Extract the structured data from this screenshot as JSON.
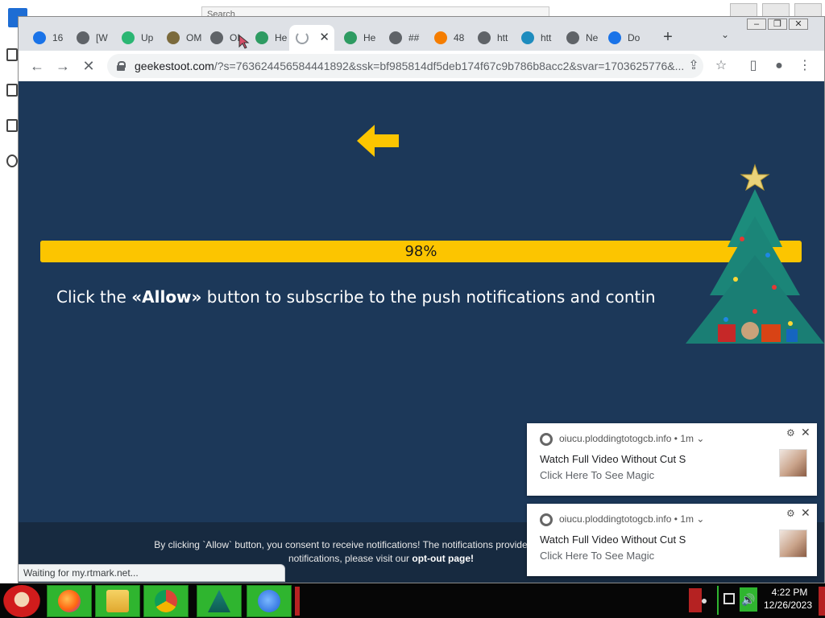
{
  "desktop": {
    "bg_window_search": "Search"
  },
  "browser": {
    "tabs": [
      {
        "label": "16",
        "favicon": "edge-icon",
        "color": "#1a73e8"
      },
      {
        "label": "[W",
        "favicon": "globe-icon",
        "color": "#5f6368"
      },
      {
        "label": "Up",
        "favicon": "upload-icon",
        "color": "#2bb673"
      },
      {
        "label": "OM",
        "favicon": "image-icon",
        "color": "#7b6a3c"
      },
      {
        "label": "OI",
        "favicon": "globe-icon",
        "color": "#5f6368"
      },
      {
        "label": "He",
        "favicon": "palm-icon",
        "color": "#2e9b62"
      },
      {
        "label": "",
        "favicon": "loading-spinner-icon",
        "color": "#9aa0a6",
        "active": true
      },
      {
        "label": "He",
        "favicon": "palm-icon",
        "color": "#2e9b62"
      },
      {
        "label": "##",
        "favicon": "globe-icon",
        "color": "#5f6368"
      },
      {
        "label": "48",
        "favicon": "blogger-icon",
        "color": "#f57d00"
      },
      {
        "label": "htt",
        "favicon": "camera-icon",
        "color": "#5f6368"
      },
      {
        "label": "htt",
        "favicon": "wordpress-icon",
        "color": "#1e8cbe"
      },
      {
        "label": "Ne",
        "favicon": "chrome-icon",
        "color": "#5f6368"
      },
      {
        "label": "Do",
        "favicon": "dot-icon",
        "color": "#1a73e8"
      }
    ],
    "url_host": "geekestoot.com",
    "url_rest": "/?s=763624456584441892&ssk=bf985814df5deb174f67c9b786b8acc2&svar=1703625776&...",
    "status_text": "Waiting for my.rtmark.net..."
  },
  "page": {
    "progress_percent": 98,
    "progress_label": "98%",
    "instruction_prefix": "Click the ",
    "instruction_allow": "«Allow»",
    "instruction_suffix": " button to subscribe to the push notifications and contin",
    "consent_text": "By clicking `Allow` button, you consent to receive notifications! The notifications provide news and advertis",
    "consent_text_line2": "notifications, please visit our ",
    "optout_label": "opt-out page!",
    "accent_color": "#fcc500",
    "background_color": "#1c3859"
  },
  "notifications": [
    {
      "origin": "oiucu.ploddingtotogcb.info",
      "age": "1m",
      "title": "Watch Full Video Without Cut S",
      "body": "Click Here To See Magic"
    },
    {
      "origin": "oiucu.ploddingtotogcb.info",
      "age": "1m",
      "title": "Watch Full Video Without Cut S",
      "body": "Click Here To See Magic"
    }
  ],
  "taskbar": {
    "time": "4:22 PM",
    "date": "12/26/2023",
    "apps": [
      "firefox-icon",
      "file-explorer-icon",
      "chrome-icon",
      "christmas-tree-icon",
      "messenger-icon"
    ]
  }
}
